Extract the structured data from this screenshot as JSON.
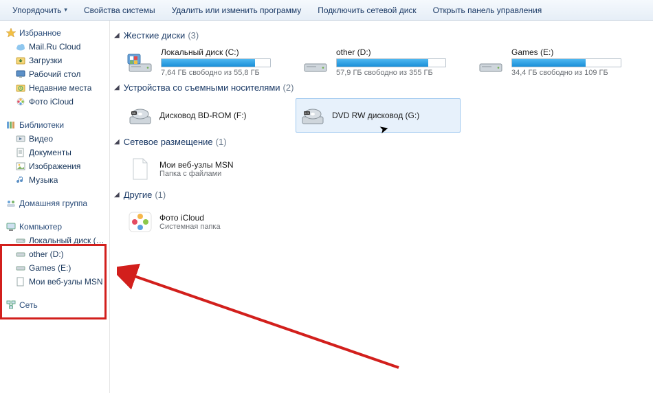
{
  "toolbar": {
    "organize": "Упорядочить",
    "system_props": "Свойства системы",
    "uninstall": "Удалить или изменить программу",
    "map_net": "Подключить сетевой диск",
    "control_panel": "Открыть панель управления"
  },
  "sidebar": {
    "favorites": {
      "title": "Избранное",
      "items": [
        "Mail.Ru Cloud",
        "Загрузки",
        "Рабочий стол",
        "Недавние места",
        "Фото iCloud"
      ]
    },
    "libraries": {
      "title": "Библиотеки",
      "items": [
        "Видео",
        "Документы",
        "Изображения",
        "Музыка"
      ]
    },
    "homegroup": "Домашняя группа",
    "computer": {
      "title": "Компьютер",
      "items": [
        "Локальный диск (C:)",
        "other (D:)",
        "Games (E:)",
        "Мои веб-узлы MSN"
      ]
    },
    "network": "Сеть"
  },
  "sections": {
    "hdd": {
      "title": "Жесткие диски",
      "count": "(3)"
    },
    "removable": {
      "title": "Устройства со съемными носителями",
      "count": "(2)"
    },
    "netloc": {
      "title": "Сетевое размещение",
      "count": "(1)"
    },
    "other": {
      "title": "Другие",
      "count": "(1)"
    }
  },
  "drives": [
    {
      "name": "Локальный диск (C:)",
      "sub": "7,64 ГБ свободно из 55,8 ГБ",
      "fill": 86
    },
    {
      "name": "other (D:)",
      "sub": "57,9 ГБ свободно из 355 ГБ",
      "fill": 84
    },
    {
      "name": "Games (E:)",
      "sub": "34,4 ГБ свободно из 109 ГБ",
      "fill": 68
    }
  ],
  "removable": [
    {
      "name": "Дисковод BD-ROM (F:)"
    },
    {
      "name": "DVD RW дисковод (G:)"
    }
  ],
  "netloc": {
    "name": "Мои веб-узлы MSN",
    "sub": "Папка с файлами"
  },
  "other_item": {
    "name": "Фото iCloud",
    "sub": "Системная папка"
  }
}
